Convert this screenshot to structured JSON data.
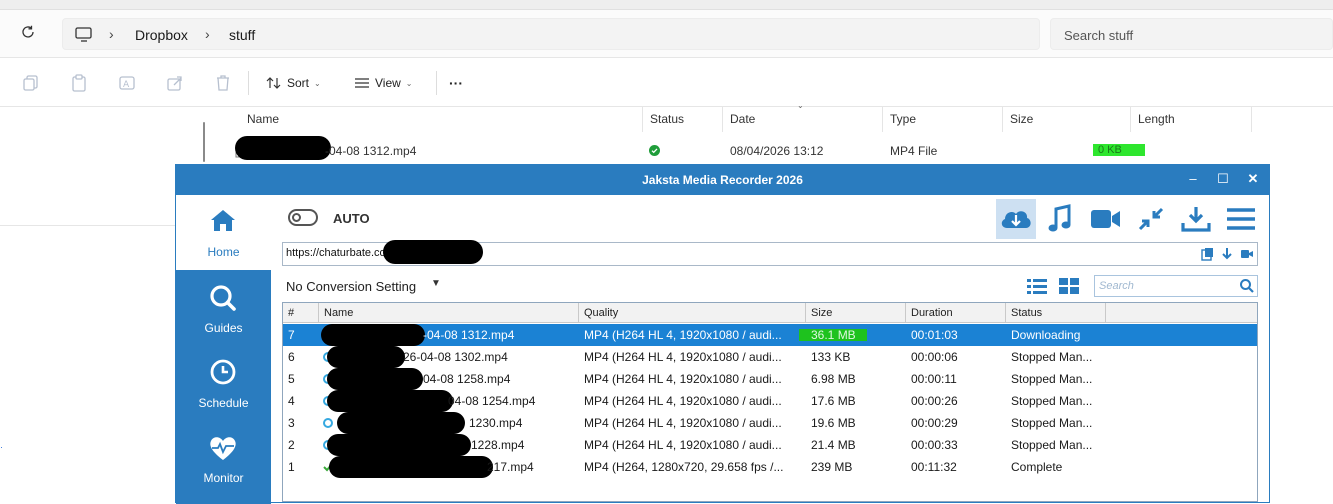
{
  "explorer": {
    "breadcrumb": [
      "Dropbox",
      "stuff"
    ],
    "search_placeholder": "Search stuff",
    "toolbar": {
      "sort_label": "Sort",
      "view_label": "View",
      "more_label": "···"
    },
    "columns": [
      "Name",
      "Status",
      "Date",
      "Type",
      "Size",
      "Length"
    ],
    "file": {
      "name_suffix": "-04-08 1312.mp4",
      "date": "08/04/2026 13:12",
      "type": "MP4 File",
      "size": "0 KB"
    }
  },
  "jaksta": {
    "title": "Jaksta Media Recorder 2026",
    "window_buttons": [
      "–",
      "☐",
      "✕"
    ],
    "nav": [
      {
        "label": "Home",
        "icon": "home-icon"
      },
      {
        "label": "Guides",
        "icon": "search-icon"
      },
      {
        "label": "Schedule",
        "icon": "clock-icon"
      },
      {
        "label": "Monitor",
        "icon": "heart-pulse-icon"
      }
    ],
    "auto_label": "AUTO",
    "url": "https://chaturbate.co",
    "conversion_setting": "No Conversion Setting",
    "search_placeholder": "Search",
    "grid_columns": [
      "#",
      "Name",
      "Quality",
      "Size",
      "Duration",
      "Status"
    ],
    "rows": [
      {
        "num": "7",
        "name": "-04-08 1312.mp4",
        "quality": "MP4  (H264  HL  4,  1920x1080  /  audi...",
        "size": "36.1 MB",
        "duration": "00:01:03",
        "status": "Downloading"
      },
      {
        "num": "6",
        "name": "26-04-08 1302.mp4",
        "quality": "MP4  (H264  HL  4,  1920x1080  /  audi...",
        "size": "133 KB",
        "duration": "00:00:06",
        "status": "Stopped  Man..."
      },
      {
        "num": "5",
        "name": "04-08 1258.mp4",
        "quality": "MP4  (H264  HL  4,  1920x1080  /  audi...",
        "size": "6.98 MB",
        "duration": "00:00:11",
        "status": "Stopped  Man..."
      },
      {
        "num": "4",
        "name": "04-08 1254.mp4",
        "quality": "MP4  (H264  HL  4,  1920x1080  /  audi...",
        "size": "17.6 MB",
        "duration": "00:00:26",
        "status": "Stopped  Man..."
      },
      {
        "num": "3",
        "name": "1230.mp4",
        "quality": "MP4  (H264  HL  4,  1920x1080  /  audi...",
        "size": "19.6 MB",
        "duration": "00:00:29",
        "status": "Stopped  Man..."
      },
      {
        "num": "2",
        "name": "1228.mp4",
        "quality": "MP4  (H264  HL  4,  1920x1080  /  audi...",
        "size": "21.4 MB",
        "duration": "00:00:33",
        "status": "Stopped  Man..."
      },
      {
        "num": "1",
        "name": "217.mp4",
        "quality": "MP4  (H264,  1280x720,  29.658  fps  /...",
        "size": "239 MB",
        "duration": "00:11:32",
        "status": "Complete"
      }
    ]
  },
  "colors": {
    "jaksta_blue": "#2a7cbf",
    "selected_row": "#1b82d4",
    "size_highlight": "#2ee62e"
  }
}
